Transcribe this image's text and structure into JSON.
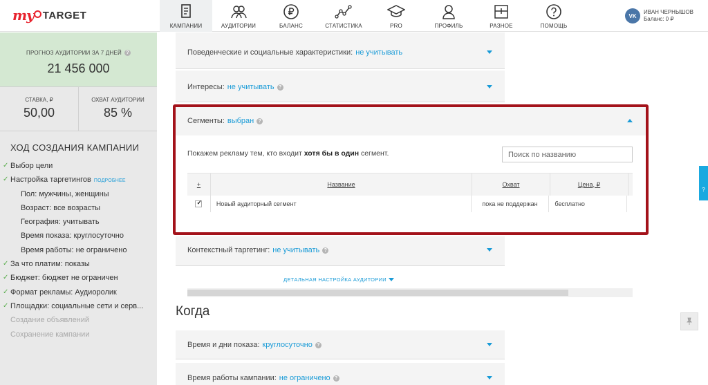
{
  "logo": {
    "my": "my",
    "target": "TARGET"
  },
  "nav": [
    {
      "label": "КАМПАНИИ",
      "icon": "campaigns-icon",
      "active": true
    },
    {
      "label": "АУДИТОРИИ",
      "icon": "audiences-icon"
    },
    {
      "label": "БАЛАНС",
      "icon": "ruble-icon"
    },
    {
      "label": "СТАТИСТИКА",
      "icon": "stats-icon"
    },
    {
      "label": "PRO",
      "icon": "graduation-cap-icon"
    },
    {
      "label": "ПРОФИЛЬ",
      "icon": "profile-icon"
    },
    {
      "label": "РАЗНОЕ",
      "icon": "misc-icon"
    },
    {
      "label": "ПОМОЩЬ",
      "icon": "help-icon"
    }
  ],
  "user": {
    "badge": "VK",
    "name": "ИВАН ЧЕРНЫШОВ",
    "balance": "Баланс: 0 ₽"
  },
  "sidebar": {
    "forecast_title": "ПРОГНОЗ АУДИТОРИИ ЗА 7 ДНЕЙ",
    "forecast_value": "21 456 000",
    "rate_title": "СТАВКА, ₽",
    "rate_value": "50,00",
    "coverage_title": "ОХВАТ АУДИТОРИИ",
    "coverage_value": "85 %",
    "steps_title": "ХОД СОЗДАНИЯ КАМПАНИИ",
    "steps": [
      {
        "label": "Выбор цели"
      },
      {
        "label": "Настройка таргетингов",
        "more": "ПОДРОБНЕЕ"
      },
      {
        "label": "Пол: мужчины, женщины"
      },
      {
        "label": "Возраст: все возрасты"
      },
      {
        "label": "География: учитывать"
      },
      {
        "label": "Время показа: круглосуточно"
      },
      {
        "label": "Время работы: не ограничено"
      },
      {
        "label": "За что платим: показы"
      },
      {
        "label": "Бюджет: бюджет не ограничен"
      },
      {
        "label": "Формат рекламы: Аудиоролик"
      },
      {
        "label": "Площадки: социальные сети и серв..."
      },
      {
        "label": "Создание объявлений"
      },
      {
        "label": "Сохранение кампании"
      }
    ]
  },
  "panels": {
    "behavioral": {
      "label": "Поведенческие и социальные характеристики:",
      "value": "не учитывать"
    },
    "interests": {
      "label": "Интересы:",
      "value": "не учитывать"
    },
    "segments": {
      "label": "Сегменты:",
      "value": "выбран"
    },
    "contextual": {
      "label": "Контекстный таргетинг:",
      "value": "не учитывать"
    },
    "time": {
      "label": "Время и дни показа:",
      "value": "круглосуточно"
    },
    "work_time": {
      "label": "Время работы кампании:",
      "value": "не ограничено"
    }
  },
  "segments": {
    "desc_pre": "Покажем рекламу тем, кто входит ",
    "desc_bold": "хотя бы в один",
    "desc_post": " сегмент.",
    "search_placeholder": "Поиск по названию",
    "table": {
      "headers": [
        "+",
        "Название",
        "Охват",
        "Цена, ₽"
      ],
      "rows": [
        {
          "checked": true,
          "name": "Новый аудиторный сегмент",
          "coverage": "пока не поддержан",
          "price": "бесплатно"
        }
      ]
    }
  },
  "detail_link": "ДЕТАЛЬНАЯ НАСТРОЙКА АУДИТОРИИ",
  "section_when": "Когда",
  "side_tab_label": "?"
}
